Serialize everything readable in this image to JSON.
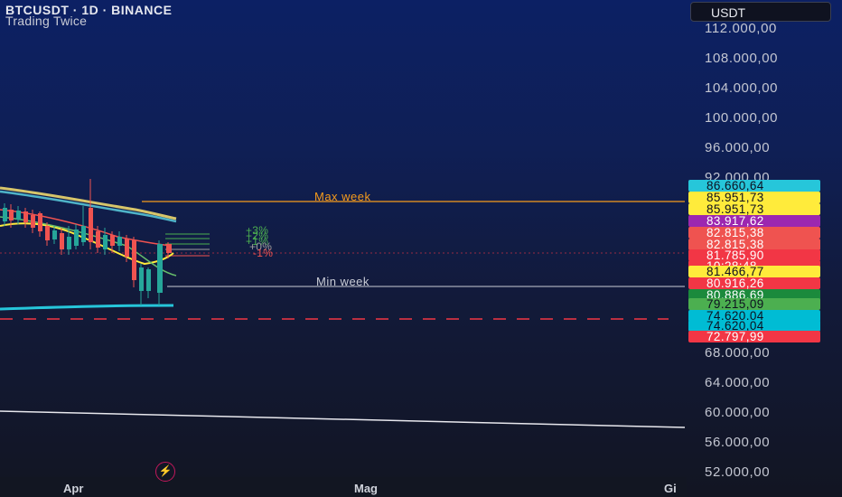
{
  "header": {
    "title": "BTCUSDT · 1D · BINANCE",
    "subtitle": "Trading Twice"
  },
  "currency_button": {
    "label": "USDT"
  },
  "price_axis": {
    "labels": [
      "112.000,00",
      "108.000,00",
      "104.000,00",
      "100.000,00",
      "96.000,00",
      "92.000,00",
      "68.000,00",
      "64.000,00",
      "60.000,00",
      "56.000,00",
      "52.000,00"
    ]
  },
  "price_tags": [
    {
      "text": "86.660,64",
      "bg": "#26c6da",
      "fg": "#0d1020"
    },
    {
      "text": "85.951,73",
      "bg": "#ffeb3b",
      "fg": "#0d1020"
    },
    {
      "text": "85.951,73",
      "bg": "#ffeb3b",
      "fg": "#0d1020"
    },
    {
      "text": "83.917,62",
      "bg": "#9c27b0",
      "fg": "#ffffff"
    },
    {
      "text": "82.815,38",
      "bg": "#ef5350",
      "fg": "#ffffff"
    },
    {
      "text": "82.815,38",
      "bg": "#ef5350",
      "fg": "#ffffff"
    },
    {
      "text": "81.785,90",
      "bg": "#f23645",
      "fg": "#ffffff"
    },
    {
      "text": "10:28:48",
      "bg": "#f23645",
      "fg": "#ffffff"
    },
    {
      "text": "81.466,77",
      "bg": "#ffeb3b",
      "fg": "#0d1020"
    },
    {
      "text": "80.916,26",
      "bg": "#f23645",
      "fg": "#ffffff"
    },
    {
      "text": "80.886,69",
      "bg": "#1b8a3c",
      "fg": "#ffffff"
    },
    {
      "text": "79.215,09",
      "bg": "#4caf50",
      "fg": "#0d1020"
    },
    {
      "text": "74.620,04",
      "bg": "#00bcd4",
      "fg": "#0d1020"
    },
    {
      "text": "74.620,04",
      "bg": "#00bcd4",
      "fg": "#0d1020"
    },
    {
      "text": "72.797,99",
      "bg": "#f23645",
      "fg": "#ffffff"
    }
  ],
  "levels": {
    "max_week": "Max week",
    "min_week": "Min week"
  },
  "percent_levels": [
    "+3%",
    "+2%",
    "+1%",
    "+0%",
    "-1%"
  ],
  "time_axis": {
    "labels": [
      "Apr",
      "Mag",
      "Gi"
    ]
  },
  "colors": {
    "max_week": "#f59b1c",
    "min_week": "#c9ccd6",
    "up": "#26a69a",
    "down": "#ef5350",
    "stop_dash": "#f23645"
  },
  "icons": {
    "flash": "lightning-icon"
  }
}
